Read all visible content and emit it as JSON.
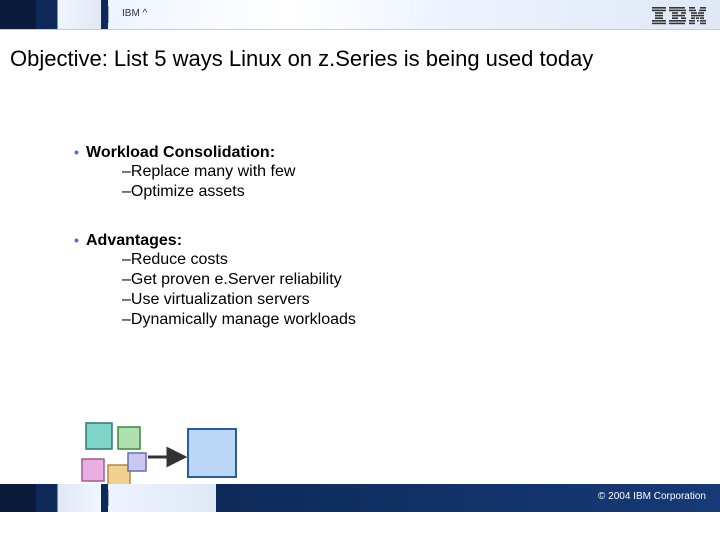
{
  "header": {
    "brand_label": "IBM ^"
  },
  "title": "Objective: List 5 ways Linux on z.Series is being used today",
  "blocks": [
    {
      "heading": "Workload Consolidation:",
      "subs": [
        "Replace many with few",
        "Optimize assets"
      ]
    },
    {
      "heading": "Advantages:",
      "subs": [
        "Reduce costs",
        "Get proven e.Server reliability",
        "Use virtualization servers",
        "Dynamically manage workloads"
      ]
    }
  ],
  "footer": {
    "copyright": "© 2004 IBM Corporation"
  }
}
